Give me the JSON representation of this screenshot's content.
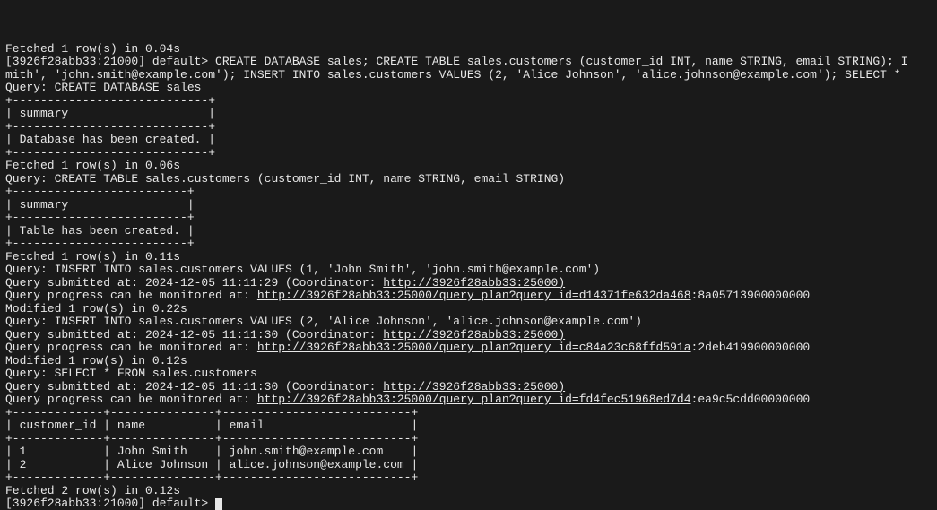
{
  "lines": {
    "l0": "Fetched 1 row(s) in 0.04s",
    "l1": "[3926f28abb33:21000] default> CREATE DATABASE sales; CREATE TABLE sales.customers (customer_id INT, name STRING, email STRING); I",
    "l2": "mith', 'john.smith@example.com'); INSERT INTO sales.customers VALUES (2, 'Alice Johnson', 'alice.johnson@example.com'); SELECT *",
    "l3": "Query: CREATE DATABASE sales",
    "l4": "+----------------------------+",
    "l5": "| summary                    |",
    "l6": "+----------------------------+",
    "l7": "| Database has been created. |",
    "l8": "+----------------------------+",
    "l9": "Fetched 1 row(s) in 0.06s",
    "l10": "Query: CREATE TABLE sales.customers (customer_id INT, name STRING, email STRING)",
    "l11": "+-------------------------+",
    "l12": "| summary                 |",
    "l13": "+-------------------------+",
    "l14": "| Table has been created. |",
    "l15": "+-------------------------+",
    "l16": "Fetched 1 row(s) in 0.11s",
    "l17": "Query: INSERT INTO sales.customers VALUES (1, 'John Smith', 'john.smith@example.com')",
    "l18a": "Query submitted at: 2024-12-05 11:11:29 (Coordinator: ",
    "l18b": "http://3926f28abb33:25000)",
    "l19a": "Query progress can be monitored at: ",
    "l19b": "http://3926f28abb33:25000/query_plan?query_id=d14371fe632da468",
    "l19c": ":8a05713900000000",
    "l20": "Modified 1 row(s) in 0.22s",
    "l21": "Query: INSERT INTO sales.customers VALUES (2, 'Alice Johnson', 'alice.johnson@example.com')",
    "l22a": "Query submitted at: 2024-12-05 11:11:30 (Coordinator: ",
    "l22b": "http://3926f28abb33:25000)",
    "l23a": "Query progress can be monitored at: ",
    "l23b": "http://3926f28abb33:25000/query_plan?query_id=c84a23c68ffd591a",
    "l23c": ":2deb419900000000",
    "l24": "Modified 1 row(s) in 0.12s",
    "l25": "Query: SELECT * FROM sales.customers",
    "l26a": "Query submitted at: 2024-12-05 11:11:30 (Coordinator: ",
    "l26b": "http://3926f28abb33:25000)",
    "l27a": "Query progress can be monitored at: ",
    "l27b": "http://3926f28abb33:25000/query_plan?query_id=fd4fec51968ed7d4",
    "l27c": ":ea9c5cdd00000000",
    "l28": "+-------------+---------------+---------------------------+",
    "l29": "| customer_id | name          | email                     |",
    "l30": "+-------------+---------------+---------------------------+",
    "l31": "| 1           | John Smith    | john.smith@example.com    |",
    "l32": "| 2           | Alice Johnson | alice.johnson@example.com |",
    "l33": "+-------------+---------------+---------------------------+",
    "l34": "Fetched 2 row(s) in 0.12s",
    "l35": "[3926f28abb33:21000] default> "
  },
  "result_table": {
    "columns": [
      "customer_id",
      "name",
      "email"
    ],
    "rows": [
      {
        "customer_id": 1,
        "name": "John Smith",
        "email": "john.smith@example.com"
      },
      {
        "customer_id": 2,
        "name": "Alice Johnson",
        "email": "alice.johnson@example.com"
      }
    ]
  },
  "prompt": "[3926f28abb33:21000] default>",
  "timings": {
    "fetch0": "0.04s",
    "fetch1": "0.06s",
    "fetch2": "0.11s",
    "mod1": "0.22s",
    "mod2": "0.12s",
    "fetch3": "0.12s"
  }
}
